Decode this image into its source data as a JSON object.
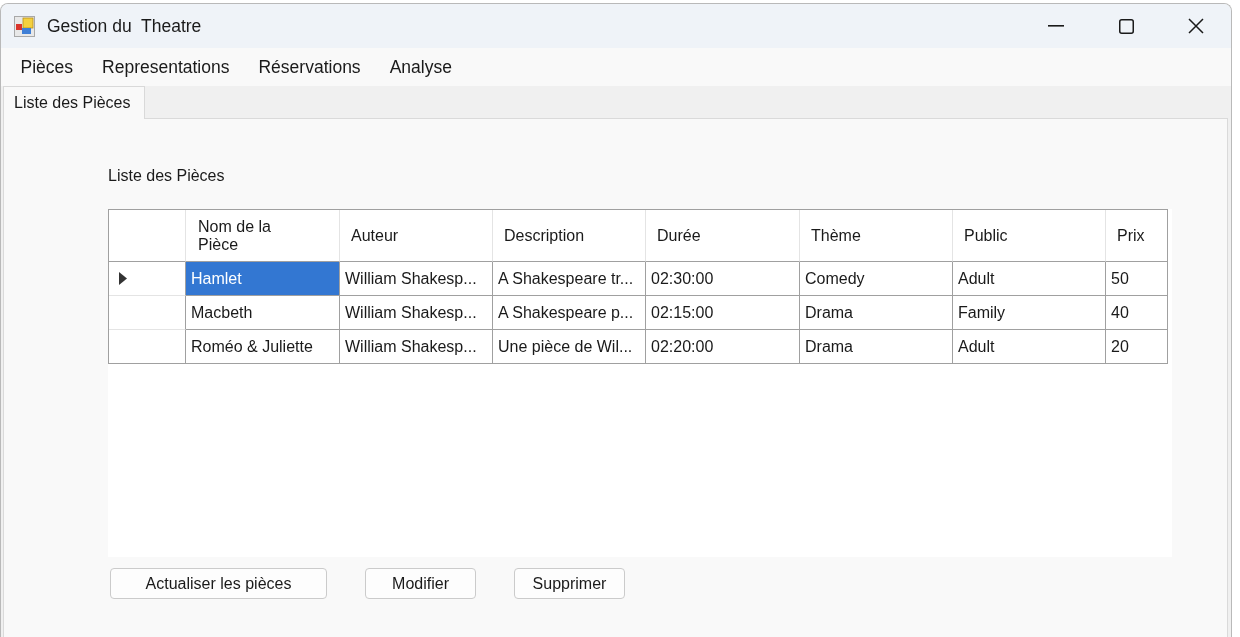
{
  "window": {
    "title": "Gestion du  Theatre"
  },
  "menu": [
    "Pièces",
    "Representations",
    "Réservations",
    "Analyse"
  ],
  "tabs": [
    {
      "label": "Liste des Pièces",
      "selected": true
    }
  ],
  "page": {
    "heading": "Liste des Pièces",
    "table": {
      "columns": [
        "Nom de la Pièce",
        "Auteur",
        "Description",
        "Durée",
        "Thème",
        "Public",
        "Prix"
      ],
      "rows": [
        {
          "current": true,
          "cells": [
            {
              "text": "Hamlet",
              "selected": true
            },
            {
              "text": "William Shakesp...",
              "selected": false
            },
            {
              "text": "A Shakespeare tr...",
              "selected": false
            },
            {
              "text": "02:30:00",
              "selected": false
            },
            {
              "text": "Comedy",
              "selected": false
            },
            {
              "text": "Adult",
              "selected": false
            },
            {
              "text": "50",
              "selected": false
            }
          ]
        },
        {
          "current": false,
          "cells": [
            {
              "text": "Macbeth",
              "selected": false
            },
            {
              "text": "William Shakesp...",
              "selected": false
            },
            {
              "text": "A Shakespeare p...",
              "selected": false
            },
            {
              "text": "02:15:00",
              "selected": false
            },
            {
              "text": "Drama",
              "selected": false
            },
            {
              "text": "Family",
              "selected": false
            },
            {
              "text": "40",
              "selected": false
            }
          ]
        },
        {
          "current": false,
          "cells": [
            {
              "text": "Roméo & Juliette",
              "selected": false
            },
            {
              "text": "William Shakesp...",
              "selected": false
            },
            {
              "text": "Une pièce de Wil...",
              "selected": false
            },
            {
              "text": "02:20:00",
              "selected": false
            },
            {
              "text": "Drama",
              "selected": false
            },
            {
              "text": "Adult",
              "selected": false
            },
            {
              "text": "20",
              "selected": false
            }
          ]
        }
      ]
    },
    "buttons": [
      "Actualiser les pièces",
      "Modifier",
      "Supprimer"
    ]
  }
}
